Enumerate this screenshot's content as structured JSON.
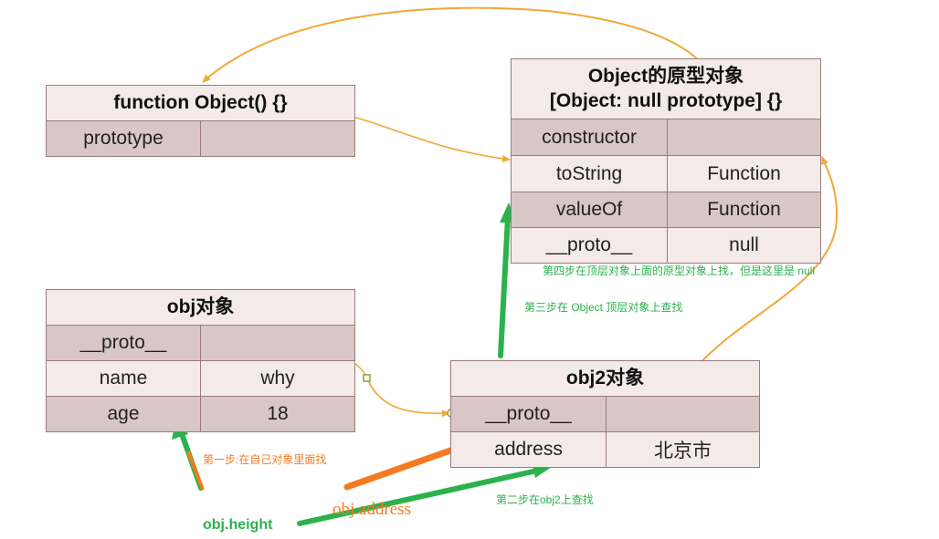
{
  "function_object": {
    "title": "function Object() {}",
    "rows": [
      {
        "key": "prototype",
        "value": ""
      }
    ]
  },
  "object_prototype": {
    "title_line1": "Object的原型对象",
    "title_line2": "[Object: null prototype] {}",
    "rows": [
      {
        "key": "constructor",
        "value": ""
      },
      {
        "key": "toString",
        "value": "Function"
      },
      {
        "key": "valueOf",
        "value": "Function"
      },
      {
        "key": "__proto__",
        "value": "null"
      }
    ]
  },
  "obj": {
    "title": "obj对象",
    "rows": [
      {
        "key": "__proto__",
        "value": ""
      },
      {
        "key": "name",
        "value": "why"
      },
      {
        "key": "age",
        "value": "18"
      }
    ]
  },
  "obj2": {
    "title": "obj2对象",
    "rows": [
      {
        "key": "__proto__",
        "value": ""
      },
      {
        "key": "address",
        "value": "北京市"
      }
    ]
  },
  "notes": {
    "step1": "第一步:在自己对象里面找",
    "step2": "第二步在obj2上查找",
    "step3": "第三步在 Object 顶层对象上查找",
    "step4": "第四步在顶层对象上面的原型对象上找，但是这里是 null"
  },
  "labels": {
    "obj_height": "obj.height",
    "obj_address": "obj.address"
  },
  "colors": {
    "link_arrow": "#f0a838",
    "green_arrow": "#2bb24c",
    "orange_arrow": "#f47b20"
  }
}
